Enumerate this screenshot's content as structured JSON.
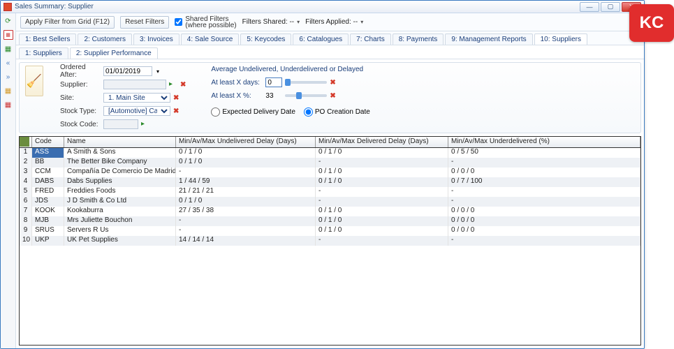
{
  "window": {
    "title": "Sales Summary: Supplier"
  },
  "toolbar": {
    "apply": "Apply Filter from Grid (F12)",
    "reset": "Reset Filters",
    "shared": "Shared Filters\n(where possible)",
    "filters_shared": "Filters Shared:",
    "filters_shared_val": "--",
    "filters_applied": "Filters Applied:",
    "filters_applied_val": "--"
  },
  "tabs": [
    "1: Best Sellers",
    "2: Customers",
    "3: Invoices",
    "4: Sale Source",
    "5: Keycodes",
    "6: Catalogues",
    "7: Charts",
    "8: Payments",
    "9: Management Reports",
    "10: Suppliers"
  ],
  "active_tab": 9,
  "subtabs": [
    "1: Suppliers",
    "2: Supplier Performance"
  ],
  "active_subtab": 1,
  "filters": {
    "ordered_after_label": "Ordered After:",
    "ordered_after": "01/01/2019",
    "supplier_label": "Supplier:",
    "supplier": "",
    "site_label": "Site:",
    "site": "1. Main Site",
    "stock_type_label": "Stock Type:",
    "stock_type": "[Automotive] Car Care",
    "stock_code_label": "Stock Code:",
    "stock_code": "",
    "avg_header": "Average Undelivered, Underdelivered or Delayed",
    "x_days_label": "At least X days:",
    "x_days": "0",
    "x_pct_label": "At least X %:",
    "x_pct": "33",
    "radio_expected": "Expected Delivery Date",
    "radio_po": "PO Creation Date"
  },
  "columns": [
    "",
    "Code",
    "Name",
    "Min/Av/Max Undelivered Delay (Days)",
    "Min/Av/Max Delivered Delay (Days)",
    "Min/Av/Max Underdelivered (%)"
  ],
  "rows": [
    {
      "n": "1",
      "code": "ASS",
      "name": "A Smith & Sons",
      "un": "0 / 1 / 0",
      "del": "0 / 1 / 0",
      "pct": "0 / 5 / 50"
    },
    {
      "n": "2",
      "code": "BB",
      "name": "The Better Bike Company",
      "un": "0 / 1 / 0",
      "del": "-",
      "pct": "-"
    },
    {
      "n": "3",
      "code": "CCM",
      "name": "Compañía De Comercio De Madrid",
      "un": "-",
      "del": "0 / 1 / 0",
      "pct": "0 / 0 / 0"
    },
    {
      "n": "4",
      "code": "DABS",
      "name": "Dabs Supplies",
      "un": "1 / 44 / 59",
      "del": "0 / 1 / 0",
      "pct": "0 / 7 / 100"
    },
    {
      "n": "5",
      "code": "FRED",
      "name": "Freddies Foods",
      "un": "21 / 21 / 21",
      "del": "-",
      "pct": "-"
    },
    {
      "n": "6",
      "code": "JDS",
      "name": "J D Smith & Co Ltd",
      "un": "0 / 1 / 0",
      "del": "-",
      "pct": "-"
    },
    {
      "n": "7",
      "code": "KOOK",
      "name": "Kookaburra",
      "un": "27 / 35 / 38",
      "del": "0 / 1 / 0",
      "pct": "0 / 0 / 0"
    },
    {
      "n": "8",
      "code": "MJB",
      "name": "Mrs Juliette Bouchon",
      "un": "-",
      "del": "0 / 1 / 0",
      "pct": "0 / 0 / 0"
    },
    {
      "n": "9",
      "code": "SRUS",
      "name": "Servers R Us",
      "un": "-",
      "del": "0 / 1 / 0",
      "pct": "0 / 0 / 0"
    },
    {
      "n": "10",
      "code": "UKP",
      "name": "UK Pet Supplies",
      "un": "14 / 14 / 14",
      "del": "-",
      "pct": "-"
    }
  ],
  "kc": "KC"
}
